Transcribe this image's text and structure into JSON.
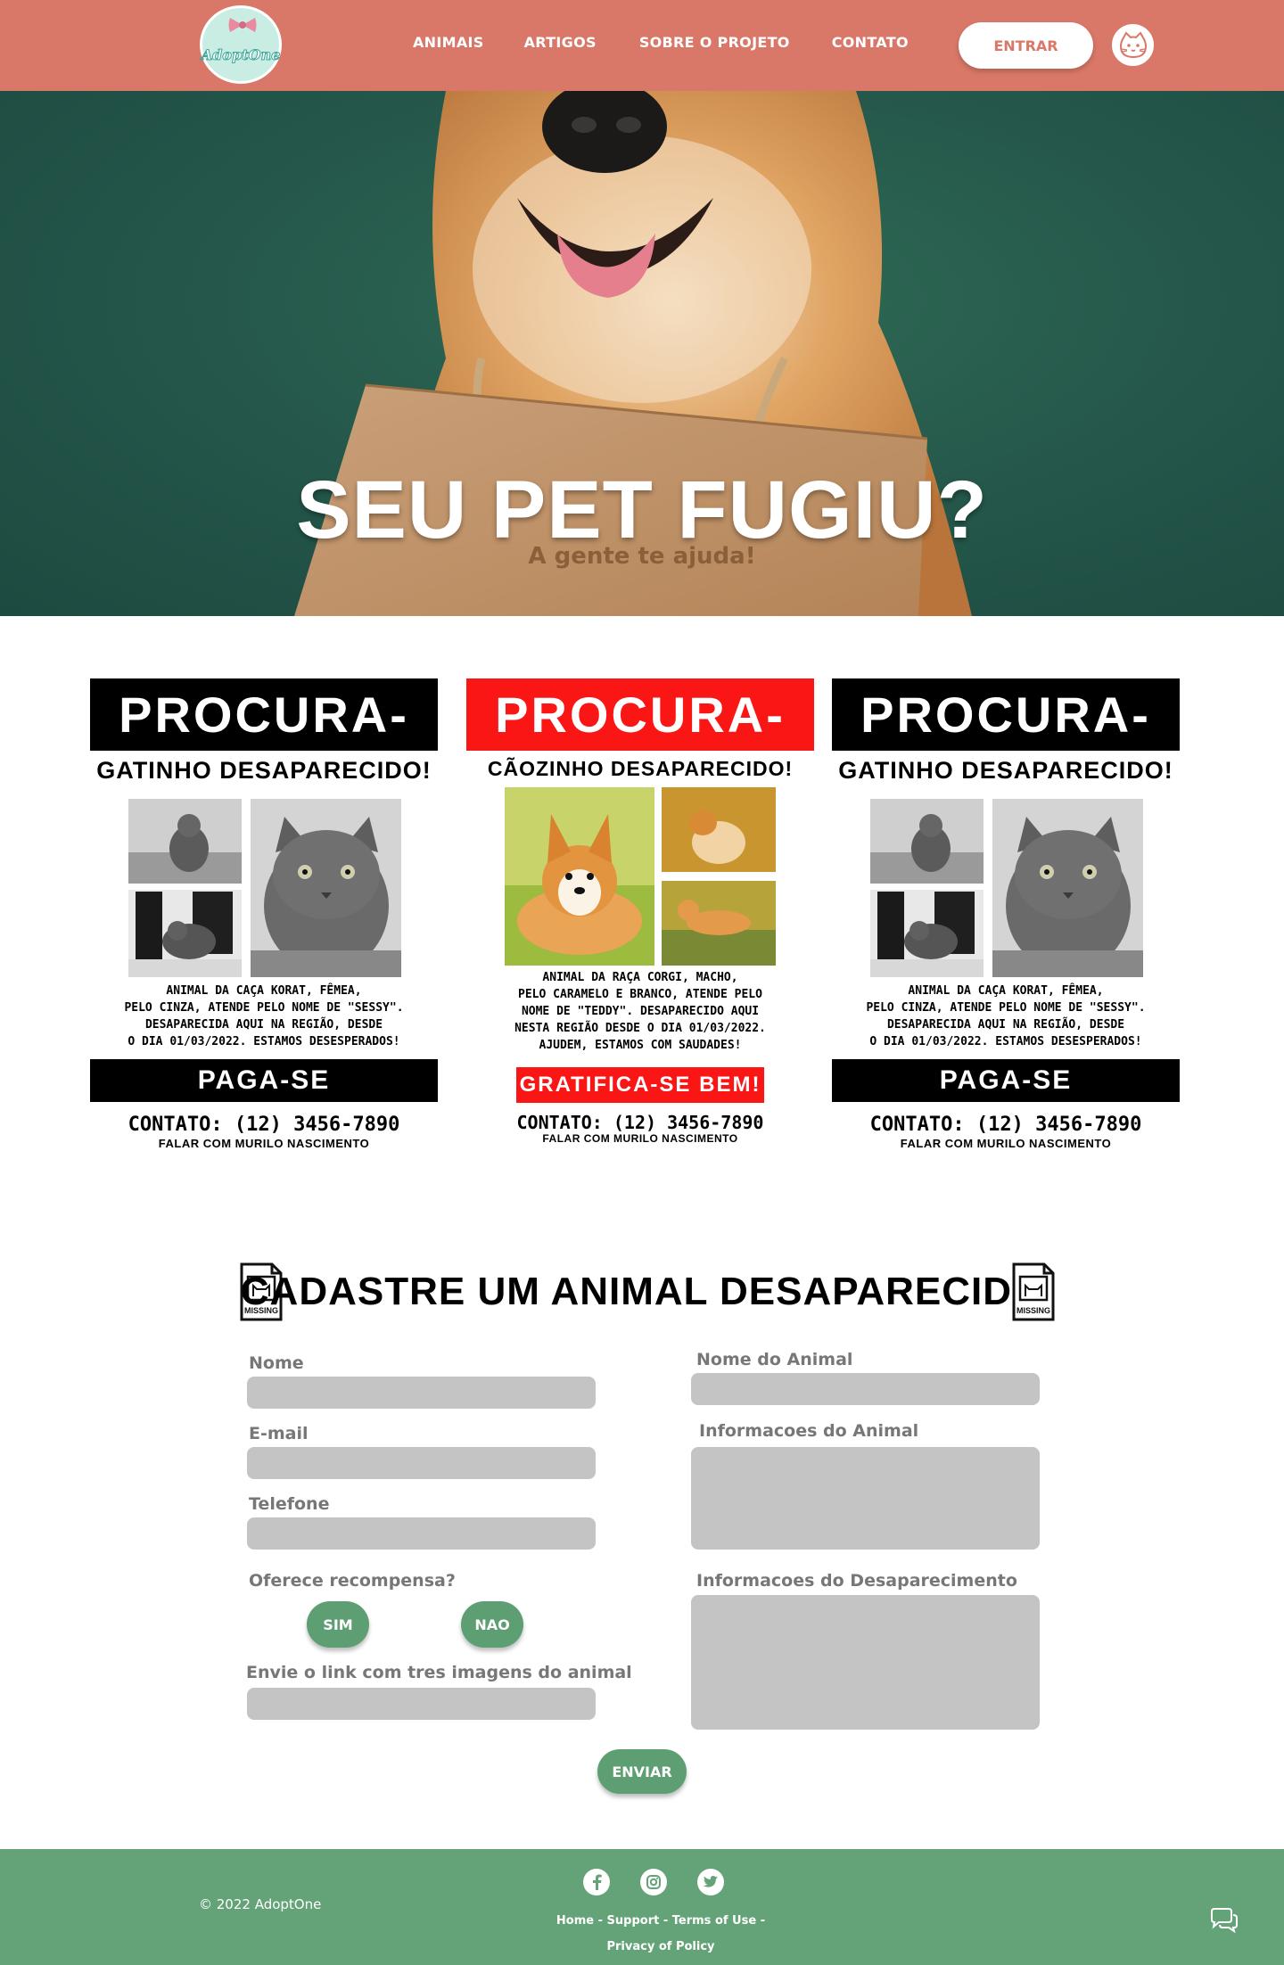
{
  "nav": {
    "logo_text": "AdoptOne",
    "menu": [
      "ANIMAIS",
      "ARTIGOS",
      "SOBRE O PROJETO",
      "CONTATO"
    ],
    "login_label": "ENTRAR",
    "avatar_icon": "cat-face-icon"
  },
  "hero": {
    "title": "SEU PET FUGIU?",
    "subtitle": "A gente te ajuda!"
  },
  "posters": [
    {
      "header": "PROCURA-SE:",
      "header_color": "#000000",
      "subheader": "GATINHO DESAPARECIDO!",
      "description": "ANIMAL DA CAÇA KORAT, FÊMEA,\nPELO CINZA, ATENDE PELO NOME DE \"SESSY\".\nDESAPARECIDA AQUI NA REGIÃO, DESDE\nO DIA 01/03/2022. ESTAMOS DESESPERADOS!",
      "reward": "PAGA-SE RECOMPENSA!",
      "contact": "CONTATO: (12) 3456-7890",
      "contact_sub": "FALAR COM MURILO NASCIMENTO"
    },
    {
      "header": "PROCURA-SE:",
      "header_color": "#fb1616",
      "subheader": "CÃOZINHO DESAPARECIDO!",
      "description": "ANIMAL DA RAÇA CORGI, MACHO,\nPELO CARAMELO E BRANCO, ATENDE PELO\nNOME DE \"TEDDY\". DESAPARECIDO AQUI\nNESTA REGIÃO DESDE O DIA 01/03/2022.\nAJUDEM, ESTAMOS COM SAUDADES!",
      "reward": "GRATIFICA-SE BEM!",
      "contact": "CONTATO: (12) 3456-7890",
      "contact_sub": "FALAR COM MURILO NASCIMENTO"
    },
    {
      "header": "PROCURA-SE:",
      "header_color": "#000000",
      "subheader": "GATINHO DESAPARECIDO!",
      "description": "ANIMAL DA CAÇA KORAT, FÊMEA,\nPELO CINZA, ATENDE PELO NOME DE \"SESSY\".\nDESAPARECIDA AQUI NA REGIÃO, DESDE\nO DIA 01/03/2022. ESTAMOS DESESPERADOS!",
      "reward": "PAGA-SE RECOMPENSA!",
      "contact": "CONTATO: (12) 3456-7890",
      "contact_sub": "FALAR COM MURILO NASCIMENTO"
    }
  ],
  "form": {
    "title": "CADASTRE UM ANIMAL DESAPARECIDO",
    "missing_icon_text": "MISSING",
    "fields": {
      "nome": "Nome",
      "email": "E-mail",
      "telefone": "Telefone",
      "recompensa": "Oferece recompensa?",
      "link": "Envie o link com tres imagens do animal",
      "nome_animal": "Nome do Animal",
      "info_animal": "Informacoes do Animal",
      "info_desaparecimento": "Informacoes do Desaparecimento"
    },
    "yes_label": "SIM",
    "no_label": "NAO",
    "submit_label": "ENVIAR"
  },
  "footer": {
    "copyright": "© 2022 AdoptOne",
    "social": [
      "facebook-icon",
      "instagram-icon",
      "twitter-icon"
    ],
    "links_line1": "Home - Support - Terms of Use -",
    "links_line2": "Privacy of Policy",
    "chat_icon": "chat-bubbles-icon"
  },
  "colors": {
    "nav_bg": "#d97868",
    "hero_bg": "#24564a",
    "accent_green": "#5e9e73",
    "footer_bg": "#64a377",
    "poster_red": "#fb1616",
    "input_gray": "#c4c4c4"
  }
}
